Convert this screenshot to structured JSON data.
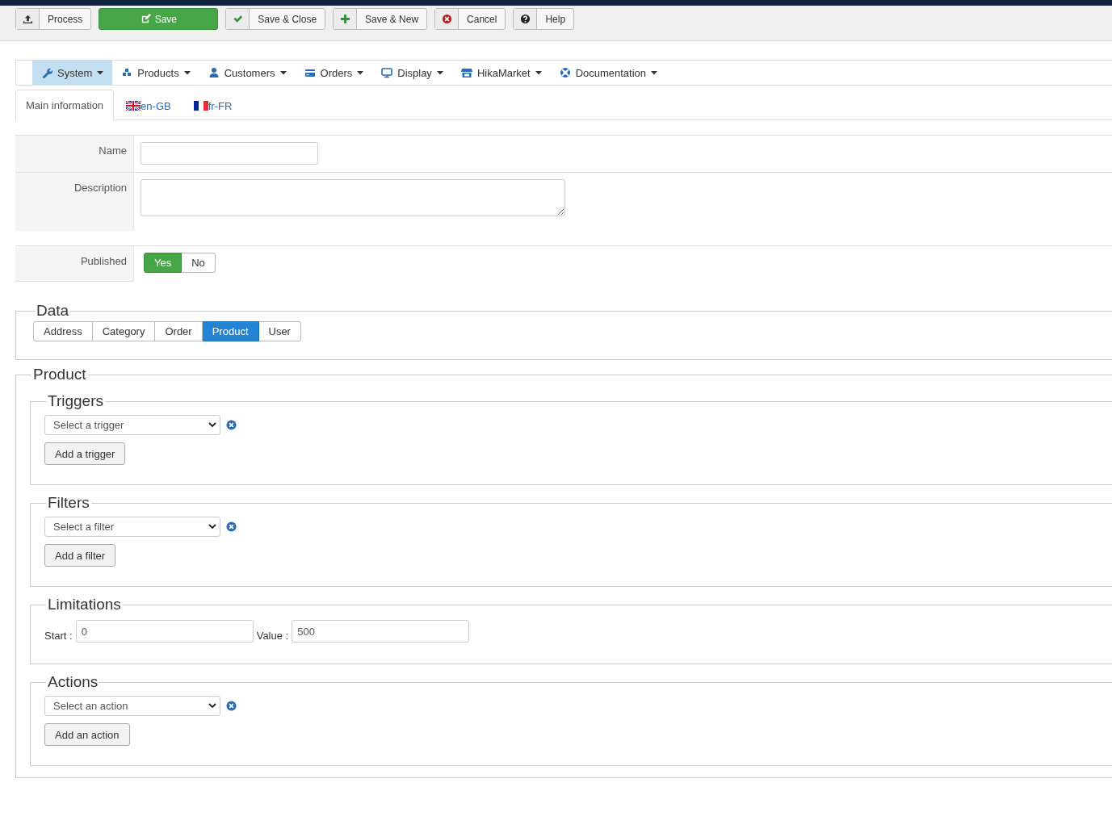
{
  "toolbar": [
    {
      "label": "Process",
      "kind": "default"
    },
    {
      "label": "Save",
      "kind": "primary"
    },
    {
      "label": "Save & Close",
      "kind": "default"
    },
    {
      "label": "Save & New",
      "kind": "default"
    },
    {
      "label": "Cancel",
      "kind": "default"
    },
    {
      "label": "Help",
      "kind": "default"
    }
  ],
  "menu": [
    {
      "label": "System",
      "selected": true
    },
    {
      "label": "Products",
      "selected": false
    },
    {
      "label": "Customers",
      "selected": false
    },
    {
      "label": "Orders",
      "selected": false
    },
    {
      "label": "Display",
      "selected": false
    },
    {
      "label": "HikaMarket",
      "selected": false
    },
    {
      "label": "Documentation",
      "selected": false
    }
  ],
  "tabs": [
    {
      "label": "Main information",
      "selected": true
    },
    {
      "label": "en-GB",
      "selected": false
    },
    {
      "label": "fr-FR",
      "selected": false
    }
  ],
  "form": [
    {
      "label": "Name",
      "kind": "input"
    },
    {
      "label": "Description",
      "kind": "textarea"
    },
    {
      "label": "Published",
      "kind": "toggle",
      "options": [
        {
          "label": "Yes",
          "selected": true
        },
        {
          "label": "No",
          "selected": false
        }
      ]
    }
  ],
  "data": {
    "title": "Data",
    "options": [
      {
        "label": "Address",
        "selected": false
      },
      {
        "label": "Category",
        "selected": false
      },
      {
        "label": "Order",
        "selected": false
      },
      {
        "label": "Product",
        "selected": true
      },
      {
        "label": "User",
        "selected": false
      }
    ]
  },
  "product": {
    "title": "Product",
    "sections": [
      {
        "title": "Triggers",
        "kind": "select",
        "select": "Select a trigger",
        "button": "Add a trigger"
      },
      {
        "title": "Filters",
        "kind": "select",
        "select": "Select a filter",
        "button": "Add a filter"
      },
      {
        "title": "Limitations",
        "kind": "range",
        "fields": [
          {
            "label": "Start :",
            "value": "0"
          },
          {
            "label": "Value :",
            "value": "500"
          }
        ]
      },
      {
        "title": "Actions",
        "kind": "select",
        "select": "Select an action",
        "button": "Add an action"
      }
    ]
  }
}
